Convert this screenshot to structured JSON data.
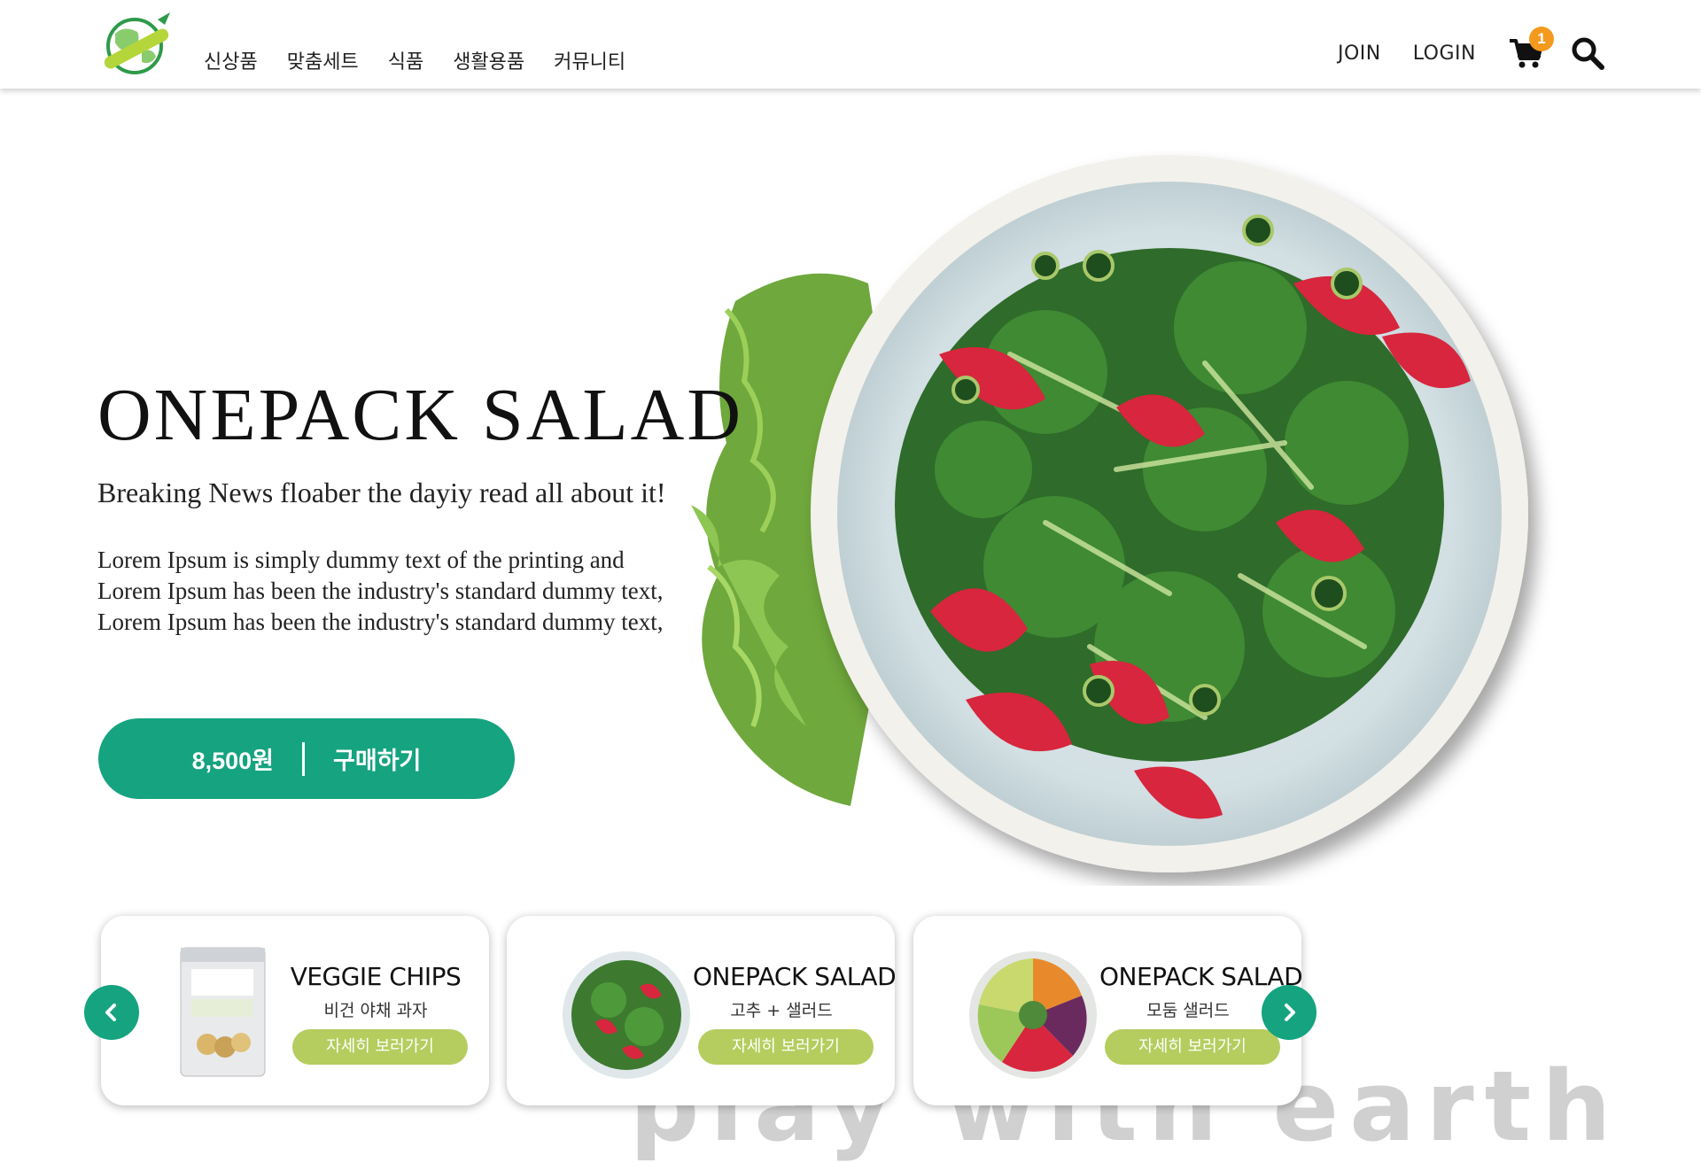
{
  "header": {
    "nav": [
      "신상품",
      "맞춤세트",
      "식품",
      "생활용품",
      "커뮤니티"
    ],
    "join": "JOIN",
    "login": "LOGIN",
    "cart_count": "1"
  },
  "hero": {
    "title": "ONEPACK SALAD",
    "subtitle": "Breaking News floaber the dayiy read all about it!",
    "description": "Lorem Ipsum is simply dummy text of the printing and Lorem Ipsum has been the industry's standard dummy text, Lorem Ipsum has been the industry's standard dummy text,",
    "price": "8,500원",
    "buy_label": "구매하기"
  },
  "products": [
    {
      "title": "VEGGIE CHIPS",
      "subtitle": "비건 야채 과자",
      "button": "자세히 보러가기"
    },
    {
      "title": "ONEPACK SALAD",
      "subtitle": "고추 + 샐러드",
      "button": "자세히 보러가기"
    },
    {
      "title": "ONEPACK SALAD",
      "subtitle": "모둠 샐러드",
      "button": "자세히 보러가기"
    }
  ],
  "watermark": "'play with earth",
  "colors": {
    "primary": "#15a380",
    "card_button": "#b5cd5e",
    "badge": "#f39a1e"
  }
}
